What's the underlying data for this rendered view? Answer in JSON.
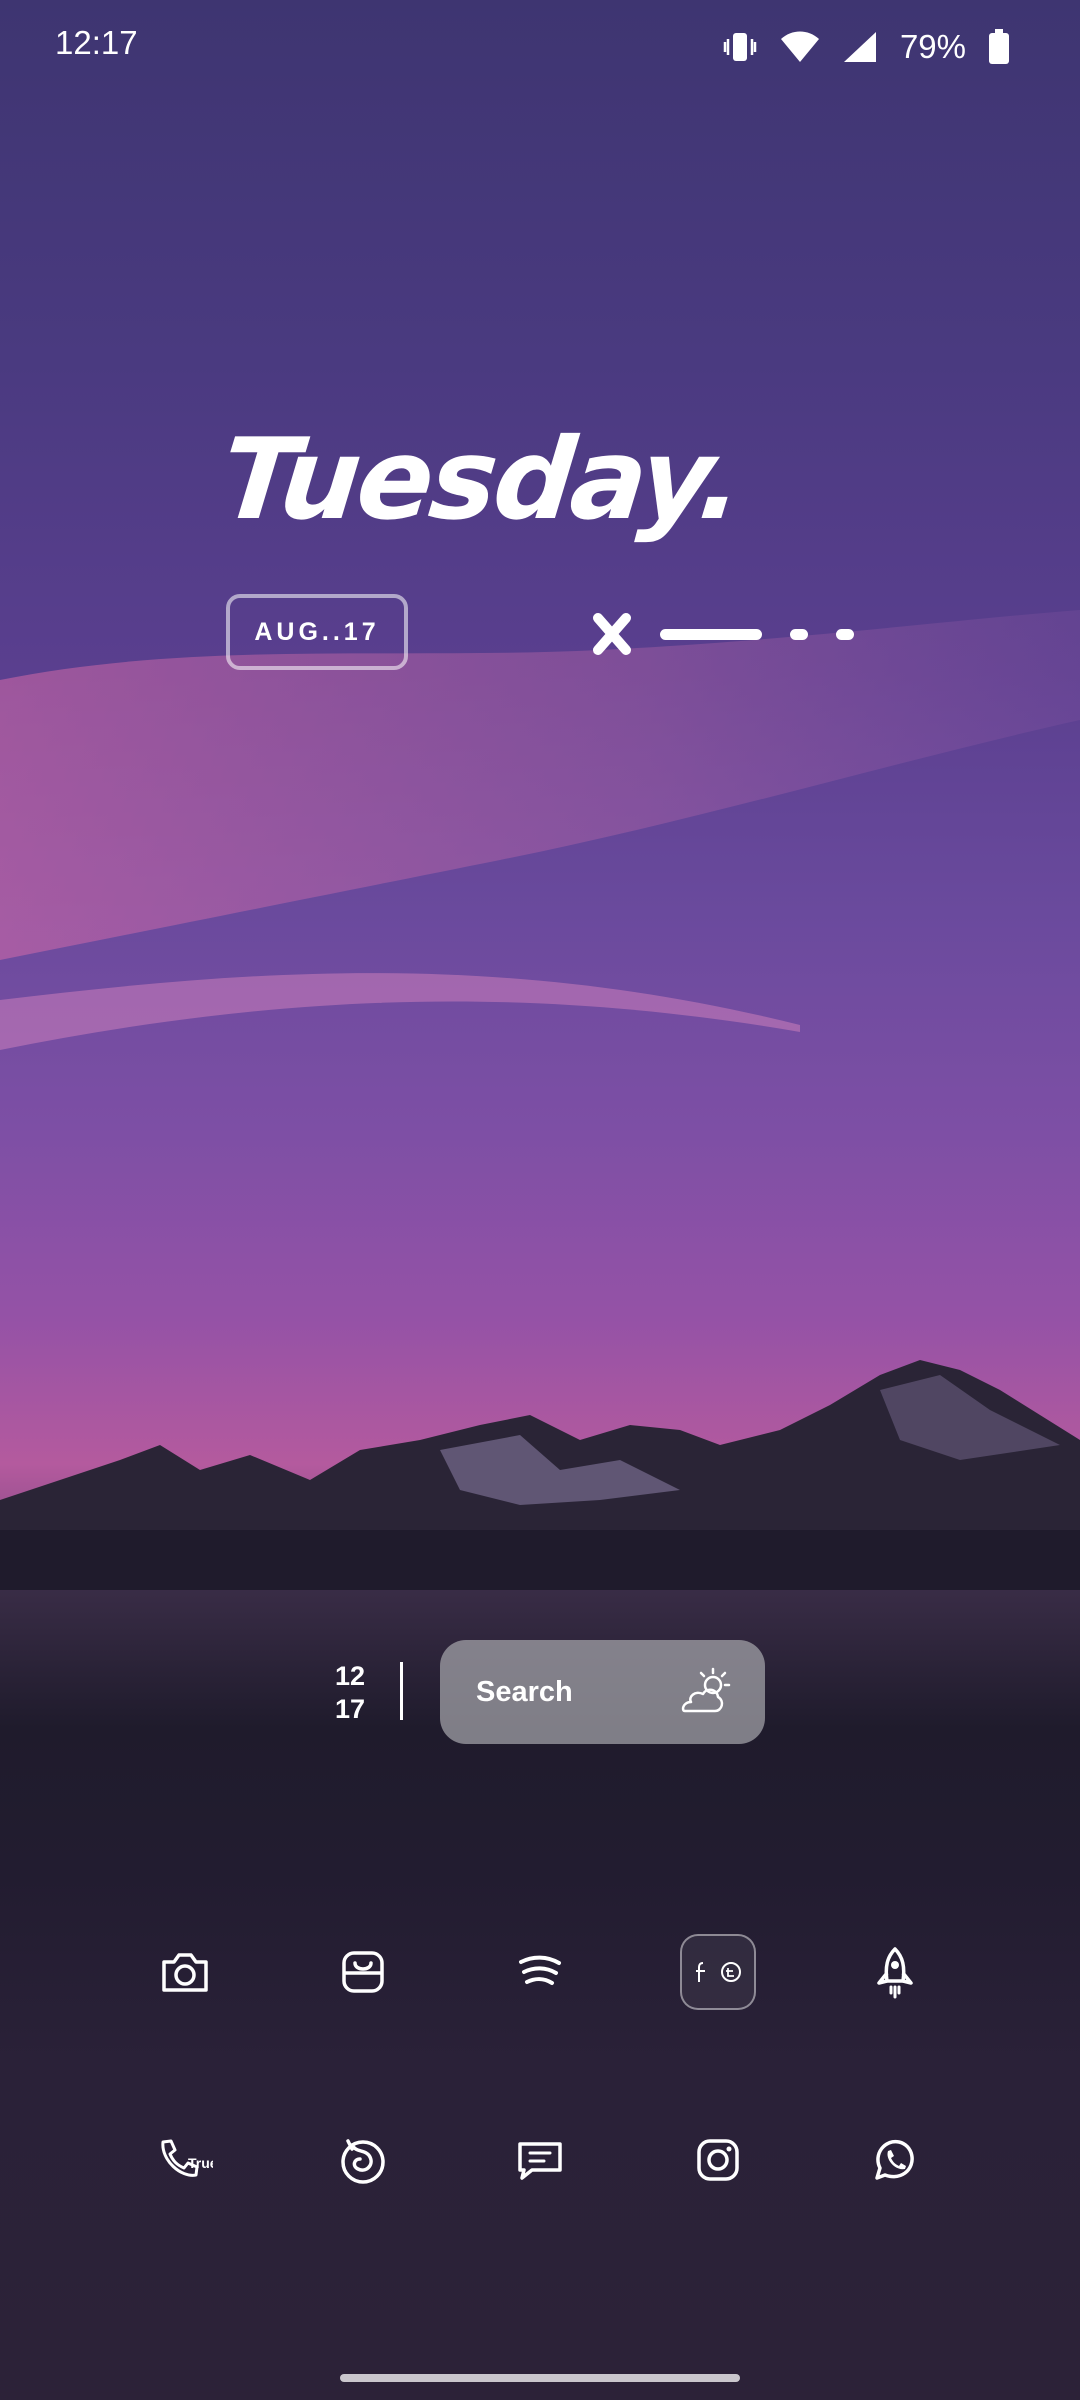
{
  "status_bar": {
    "time": "12:17",
    "battery_percent": "79%",
    "icons": [
      "vibrate-icon",
      "wifi-icon",
      "signal-icon",
      "battery-icon"
    ]
  },
  "widget": {
    "day": "Tuesday.",
    "date": "AUG..17"
  },
  "search_widget": {
    "clock_hour": "12",
    "clock_minute": "17",
    "search_label": "Search",
    "weather_icon": "partly-cloudy-icon"
  },
  "dock": {
    "row1": [
      "camera-icon",
      "store-bag-icon",
      "spotify-icon",
      "social-folder",
      "rocket-icon"
    ],
    "folder_glyphs": [
      "f",
      "t"
    ],
    "row2": [
      "truecaller-icon",
      "firefox-icon",
      "messages-icon",
      "instagram-icon",
      "whatsapp-icon"
    ],
    "truecaller_text": "True"
  },
  "colors": {
    "sky_top": "#3e3571",
    "sky_pink": "#b45a9e",
    "mountain": "#1f1b2c",
    "pill": "#a5a5aa"
  }
}
